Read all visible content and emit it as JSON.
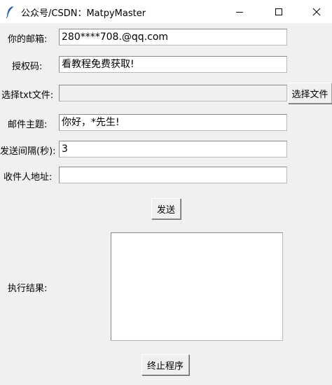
{
  "window": {
    "title": "公众号/CSDN：MatpyMaster",
    "app_icon": "feather-icon",
    "controls": [
      "minimize-icon",
      "maximize-icon",
      "close-icon"
    ]
  },
  "form": {
    "email_label": "你的邮箱:",
    "email_value": "280****708.@qq.com",
    "auth_label": "授权码:",
    "auth_value": "看教程免费获取!",
    "txt_label": "选择txt文件:",
    "txt_value": "",
    "choose_file_button": "选择文件",
    "subject_label": "邮件主题:",
    "subject_value": "你好，*先生!",
    "interval_label": "发送间隔(秒):",
    "interval_value": "3",
    "recipient_label": "收件人地址:",
    "recipient_value": "",
    "send_button": "发送",
    "result_label": "执行结果:",
    "result_value": "",
    "stop_button": "终止程序"
  }
}
